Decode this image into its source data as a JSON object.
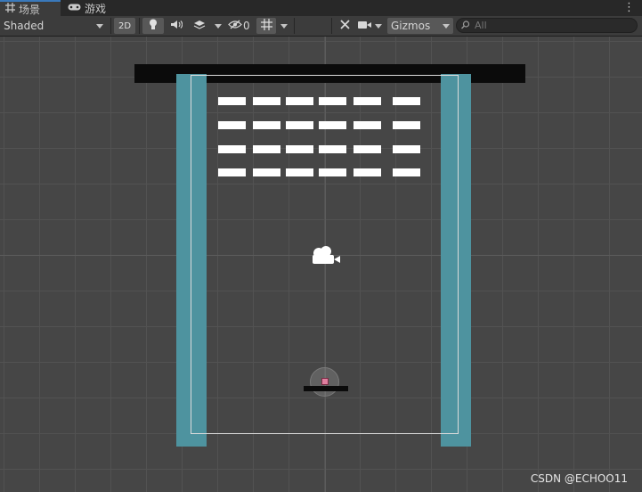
{
  "tabs": [
    {
      "icon": "grid-icon",
      "label": "场景"
    },
    {
      "icon": "gamepad-icon",
      "label": "游戏"
    }
  ],
  "toolbar": {
    "draw_mode": "Shaded",
    "two_d": "2D",
    "hidden_count": "0",
    "gizmos": "Gizmos",
    "search_placeholder": "All"
  },
  "watermark": "CSDN @ECHOO11",
  "colors": {
    "wall": "#4e939f",
    "ceiling": "#0b0b0b",
    "brick": "#ffffff",
    "paddle": "#0b0b0b",
    "ball": "#e07fa0",
    "grid": "#525252",
    "background": "#464646"
  }
}
